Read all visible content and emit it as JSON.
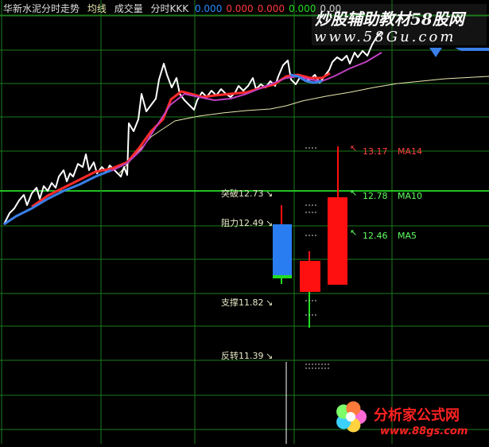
{
  "header": {
    "stock_name": "华新水泥分时走势",
    "avg_label": "均线",
    "vol_label": "成交量",
    "indicator_name": "分时KKK",
    "values": [
      "0.000",
      "0.000",
      "0.000",
      "0.000",
      "0.00"
    ],
    "value_colors": [
      "#2a8cff",
      "#ff3a3a",
      "#ff3a3a",
      "#22dd22",
      "#cccccc"
    ]
  },
  "watermark": {
    "top_line": "炒股辅助教材58股网",
    "top_url": "www.58Gu.com"
  },
  "logo": {
    "name": "分析家公式网",
    "url": "www.88gs.com"
  },
  "levels": [
    {
      "label": "突破12.73",
      "arrow": "↘"
    },
    {
      "label": "阻力12.49",
      "arrow": "↘"
    },
    {
      "label": "支撑11.82",
      "arrow": "↘"
    },
    {
      "label": "反转11.39",
      "arrow": "↘"
    }
  ],
  "ma_labels": [
    {
      "price": "13.17",
      "name": "MA14"
    },
    {
      "price": "12.78",
      "name": "MA10"
    },
    {
      "price": "12.46",
      "name": "MA5"
    }
  ],
  "colors": {
    "grid": "#1d7a1d",
    "grid_mid": "#22c022",
    "price": "#ffffff",
    "ma_red": "#ff2a2a",
    "ma_blue": "#3a7ee8",
    "ma_purple": "#c040c0",
    "avg_line": "#e8e8b0",
    "candle_up": "#ff1010",
    "candle_down": "#2a7df0",
    "label_text": "#e8e8c8",
    "ma_text": "#ff4040",
    "ma_text_green": "#60ff60"
  }
}
